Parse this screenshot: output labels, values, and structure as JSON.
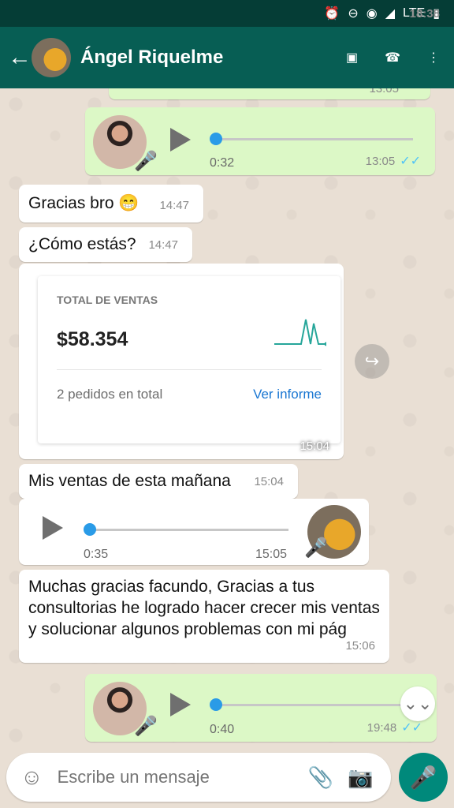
{
  "status_bar": {
    "time": "18:38",
    "signal_text": "LTE"
  },
  "header": {
    "contact_name": "Ángel Riquelme",
    "back_icon": "arrow-left-icon",
    "video_icon": "video-call-icon",
    "call_icon": "phone-icon",
    "menu_icon": "more-vert-icon"
  },
  "messages": {
    "top_partial_time": "13:05",
    "voice_1": {
      "duration": "0:32",
      "time": "13:05"
    },
    "msg_1": {
      "text": "Gracias bro 😁",
      "time": "14:47"
    },
    "msg_2": {
      "text": "¿Cómo estás?",
      "time": "14:47"
    },
    "sales_card": {
      "title": "TOTAL DE VENTAS",
      "amount": "$58.354",
      "orders": "2 pedidos en total",
      "link": "Ver informe",
      "time": "15:04"
    },
    "msg_3": {
      "text": "Mis ventas de esta mañana",
      "time": "15:04"
    },
    "voice_2": {
      "duration": "0:35",
      "time": "15:05"
    },
    "msg_4": {
      "text": "Muchas gracias facundo, Gracias a tus consultorias he logrado hacer crecer mis ventas y solucionar algunos problemas con mi pág",
      "time": "15:06"
    },
    "voice_3": {
      "duration": "0:40",
      "time": "19:48"
    }
  },
  "composer": {
    "placeholder": "Escribe un mensaje"
  },
  "colors": {
    "app_bar": "#075e54",
    "status_bar": "#053d36",
    "outgoing_bubble": "#dcf8c6",
    "incoming_bubble": "#ffffff",
    "accent": "#00897b",
    "voice_knob": "#2a9be7"
  }
}
